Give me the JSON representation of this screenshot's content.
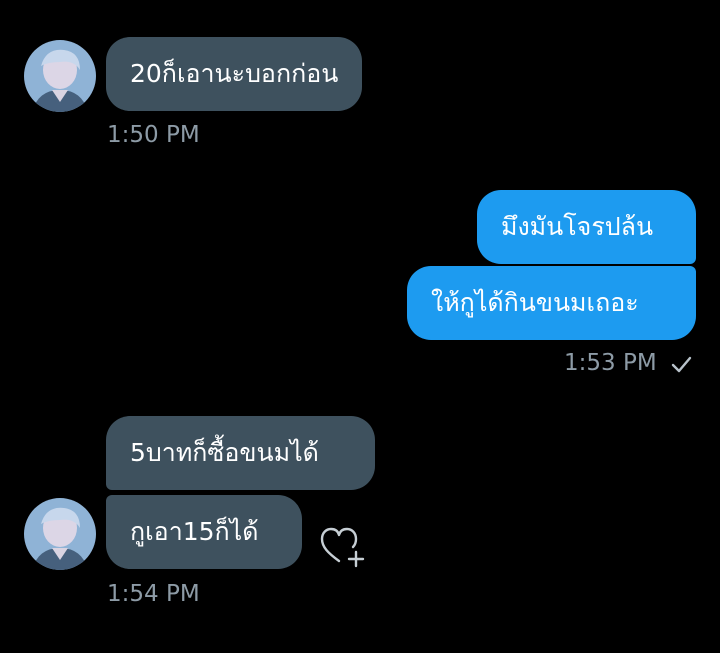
{
  "colors": {
    "background": "#000000",
    "incoming_bubble": "#3e515e",
    "outgoing_bubble": "#1d9bf0",
    "timestamp": "#8d9ba6"
  },
  "messages": {
    "m1": {
      "text": "20ก็เอานะบอกก่อน",
      "time": "1:50 PM"
    },
    "m2": {
      "text": "มึงมันโจรปล้น"
    },
    "m3": {
      "text": "ให้กูได้กินขนมเถอะ",
      "time": "1:53 PM",
      "status_icon": "check-icon"
    },
    "m4": {
      "text": "5บาทก็ซื้อขนมได้"
    },
    "m5": {
      "text": "กูเอา15ก็ได้",
      "time": "1:54 PM",
      "action_icon": "heart-plus-icon"
    }
  }
}
